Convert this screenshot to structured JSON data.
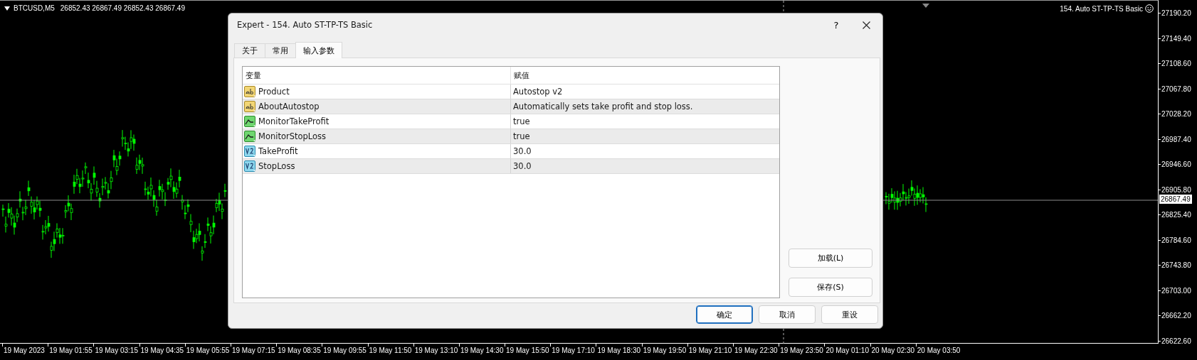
{
  "chart": {
    "symbol": "BTCUSD,M5",
    "ohlc": "26852.43 26867.49 26852.43 26867.49",
    "expert_label": "154. Auto ST-TP-TS Basic",
    "price_axis": [
      "27190.20",
      "27149.40",
      "27108.60",
      "27067.80",
      "27028.20",
      "26987.40",
      "26946.60",
      "26905.80",
      "26825.40",
      "26784.60",
      "26743.80",
      "26703.00",
      "26662.20",
      "26622.60"
    ],
    "current_price": "26867.49",
    "time_axis": [
      "19 May 2023",
      "19 May 01:55",
      "19 May 03:15",
      "19 May 04:35",
      "19 May 05:55",
      "19 May 07:15",
      "19 May 08:35",
      "19 May 09:55",
      "19 May 11:50",
      "19 May 13:10",
      "19 May 14:30",
      "19 May 15:50",
      "19 May 17:10",
      "19 May 18:30",
      "19 May 19:50",
      "19 May 21:10",
      "19 May 22:30",
      "19 May 23:50",
      "20 May 01:10",
      "20 May 02:30",
      "20 May 03:50"
    ]
  },
  "dialog": {
    "title": "Expert - 154. Auto ST-TP-TS Basic",
    "help_button": "?",
    "tabs": [
      {
        "label": "关于",
        "selected": false
      },
      {
        "label": "常用",
        "selected": false
      },
      {
        "label": "输入参数",
        "selected": true
      }
    ],
    "table": {
      "columns": [
        "变量",
        "赋值"
      ],
      "rows": [
        {
          "kind": "string",
          "name": "Product",
          "value": "Autostop v2"
        },
        {
          "kind": "string",
          "name": "AboutAutostop",
          "value": "Automatically sets take profit and stop loss."
        },
        {
          "kind": "bool",
          "name": "MonitorTakeProfit",
          "value": "true"
        },
        {
          "kind": "bool",
          "name": "MonitorStopLoss",
          "value": "true"
        },
        {
          "kind": "number",
          "name": "TakeProfit",
          "value": "30.0"
        },
        {
          "kind": "number",
          "name": "StopLoss",
          "value": "30.0"
        }
      ]
    },
    "side_buttons": [
      "加载(L)",
      "保存(S)"
    ],
    "buttons": [
      {
        "label": "确定",
        "default": true
      },
      {
        "label": "取消",
        "default": false
      },
      {
        "label": "重设",
        "default": false
      }
    ]
  }
}
